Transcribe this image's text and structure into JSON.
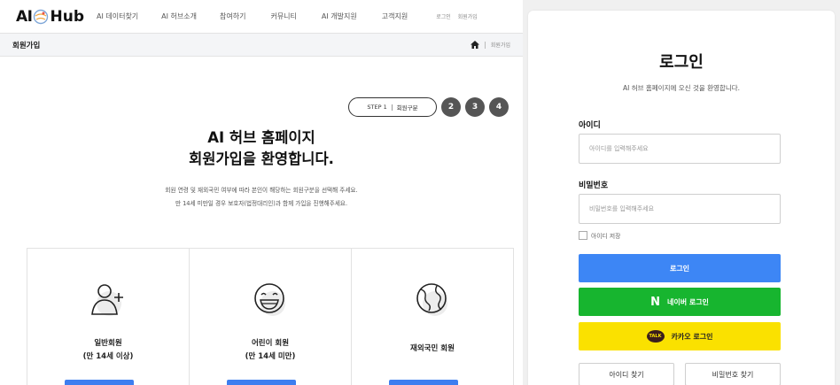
{
  "header": {
    "logo_left": "AI",
    "logo_right": "Hub",
    "nav": [
      "AI 데이터찾기",
      "AI 허브소개",
      "참여하기",
      "커뮤니티",
      "AI 개발지원",
      "고객지원"
    ],
    "aux": [
      "로그인",
      "회원가입"
    ]
  },
  "subbar": {
    "title": "회원가입",
    "crumb": "회원가입"
  },
  "steps": {
    "current_label": "STEP 1",
    "current_name": "회원구분",
    "others": [
      "2",
      "3",
      "4"
    ]
  },
  "welcome": {
    "line1": "AI 허브 홈페이지",
    "line2": "회원가입을 환영합니다.",
    "desc1": "회원 연령 및 재외국민 여부에 따라 본인이 해당하는 회원구분을 선택해 주세요.",
    "desc2": "만 14세 미만일 경우 보호자(법정대리인)과 함께 가입을 진행해주세요."
  },
  "cards": [
    {
      "icon": "person-add-icon",
      "line1": "일반회원",
      "line2": "(만 14세 이상)"
    },
    {
      "icon": "smile-face-icon",
      "line1": "어린이 회원",
      "line2": "(만 14세 미만)"
    },
    {
      "icon": "globe-icon",
      "line1": "재외국민 회원",
      "line2": ""
    }
  ],
  "login": {
    "title": "로그인",
    "subtitle": "AI 허브 홈페이지에 오신 것을 환영합니다.",
    "id_label": "아이디",
    "id_placeholder": "아이디를 입력해주세요",
    "pw_label": "비밀번호",
    "pw_placeholder": "비밀번호를 입력해주세요",
    "save_id": "아이디 저장",
    "login_button": "로그인",
    "naver_button": "네이버 로그인",
    "naver_mark": "N",
    "kakao_button": "카카오 로그인",
    "kakao_mark": "TALK",
    "find_id": "아이디 찾기",
    "find_pw": "비밀번호 찾기"
  },
  "colors": {
    "primary": "#3d86f5",
    "naver": "#17b52f",
    "kakao": "#fae100",
    "step_dot": "#555555"
  }
}
